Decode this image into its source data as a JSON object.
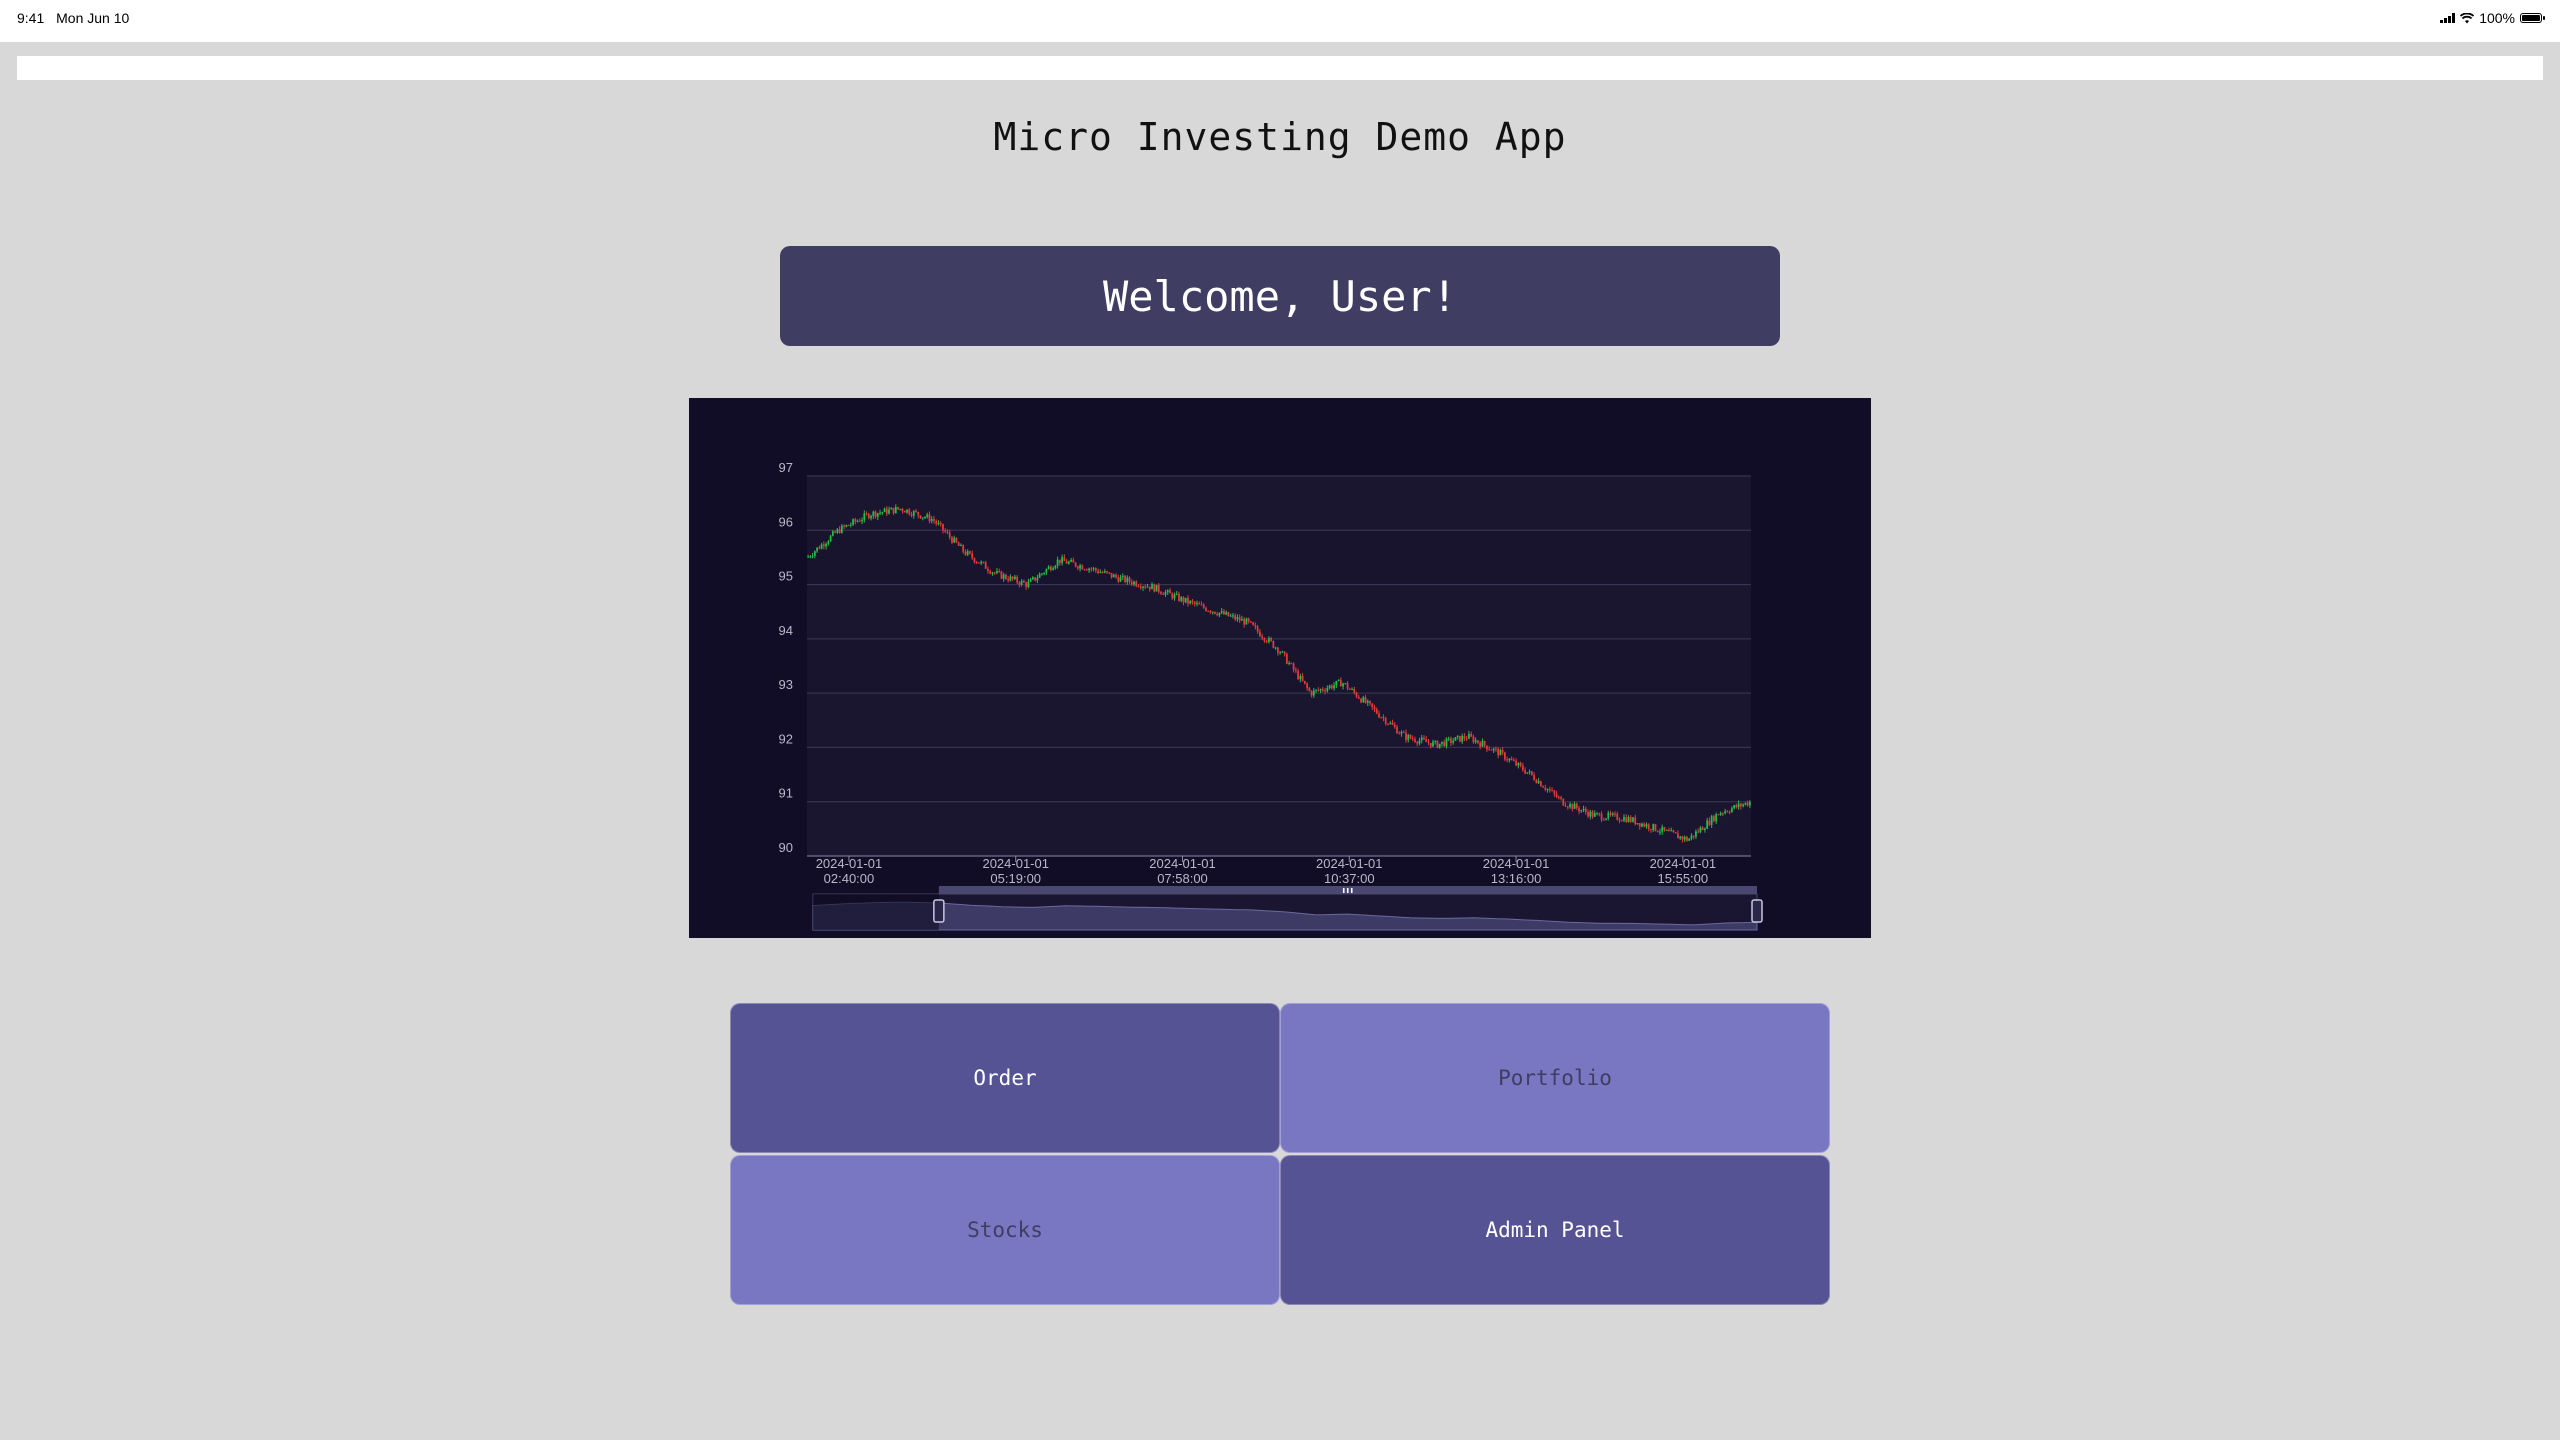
{
  "status_bar": {
    "time": "9:41",
    "date": "Mon Jun 10",
    "battery": "100%"
  },
  "app": {
    "title": "Micro Investing Demo App",
    "welcome": "Welcome, User!"
  },
  "nav": {
    "order": "Order",
    "portfolio": "Portfolio",
    "stocks": "Stocks",
    "admin": "Admin Panel"
  },
  "colors": {
    "panel_bg": "#110d26",
    "up": "#1fbf4a",
    "down": "#e03a3a",
    "welcome_bg": "#3f3d62",
    "nav_dark": "#565394",
    "nav_light": "#7977c2"
  },
  "chart_data": {
    "type": "candlestick",
    "y_ticks": [
      90,
      91,
      92,
      93,
      94,
      95,
      96,
      97
    ],
    "ylim": [
      90,
      97
    ],
    "x_ticks": [
      {
        "date": "2024-01-01",
        "time": "02:40:00"
      },
      {
        "date": "2024-01-01",
        "time": "05:19:00"
      },
      {
        "date": "2024-01-01",
        "time": "07:58:00"
      },
      {
        "date": "2024-01-01",
        "time": "10:37:00"
      },
      {
        "date": "2024-01-01",
        "time": "13:16:00"
      },
      {
        "date": "2024-01-01",
        "time": "15:55:00"
      }
    ],
    "x_range": [
      "2024-01-01 02:00:00",
      "2024-01-01 17:00:00"
    ],
    "price_path": [
      [
        "2024-01-01 02:00:00",
        95.5
      ],
      [
        "2024-01-01 02:30:00",
        96.0
      ],
      [
        "2024-01-01 03:00:00",
        96.3
      ],
      [
        "2024-01-01 03:30:00",
        96.4
      ],
      [
        "2024-01-01 04:00:00",
        96.2
      ],
      [
        "2024-01-01 04:30:00",
        95.6
      ],
      [
        "2024-01-01 05:00:00",
        95.2
      ],
      [
        "2024-01-01 05:30:00",
        95.0
      ],
      [
        "2024-01-01 06:00:00",
        95.45
      ],
      [
        "2024-01-01 06:30:00",
        95.3
      ],
      [
        "2024-01-01 07:00:00",
        95.1
      ],
      [
        "2024-01-01 07:30:00",
        94.95
      ],
      [
        "2024-01-01 08:00:00",
        94.7
      ],
      [
        "2024-01-01 08:30:00",
        94.5
      ],
      [
        "2024-01-01 09:00:00",
        94.3
      ],
      [
        "2024-01-01 09:30:00",
        93.8
      ],
      [
        "2024-01-01 10:00:00",
        93.0
      ],
      [
        "2024-01-01 10:30:00",
        93.2
      ],
      [
        "2024-01-01 11:00:00",
        92.7
      ],
      [
        "2024-01-01 11:30:00",
        92.2
      ],
      [
        "2024-01-01 12:00:00",
        92.05
      ],
      [
        "2024-01-01 12:30:00",
        92.2
      ],
      [
        "2024-01-01 13:00:00",
        91.9
      ],
      [
        "2024-01-01 13:30:00",
        91.5
      ],
      [
        "2024-01-01 14:00:00",
        91.0
      ],
      [
        "2024-01-01 14:30:00",
        90.75
      ],
      [
        "2024-01-01 15:00:00",
        90.7
      ],
      [
        "2024-01-01 15:30:00",
        90.5
      ],
      [
        "2024-01-01 16:00:00",
        90.3
      ],
      [
        "2024-01-01 16:30:00",
        90.8
      ],
      [
        "2024-01-01 17:00:00",
        91.0
      ]
    ],
    "range_selector": {
      "window": [
        "2024-01-01 02:00:00",
        "2024-01-01 17:00:00"
      ],
      "selected": [
        "2024-01-01 04:00:00",
        "2024-01-01 17:00:00"
      ]
    }
  }
}
